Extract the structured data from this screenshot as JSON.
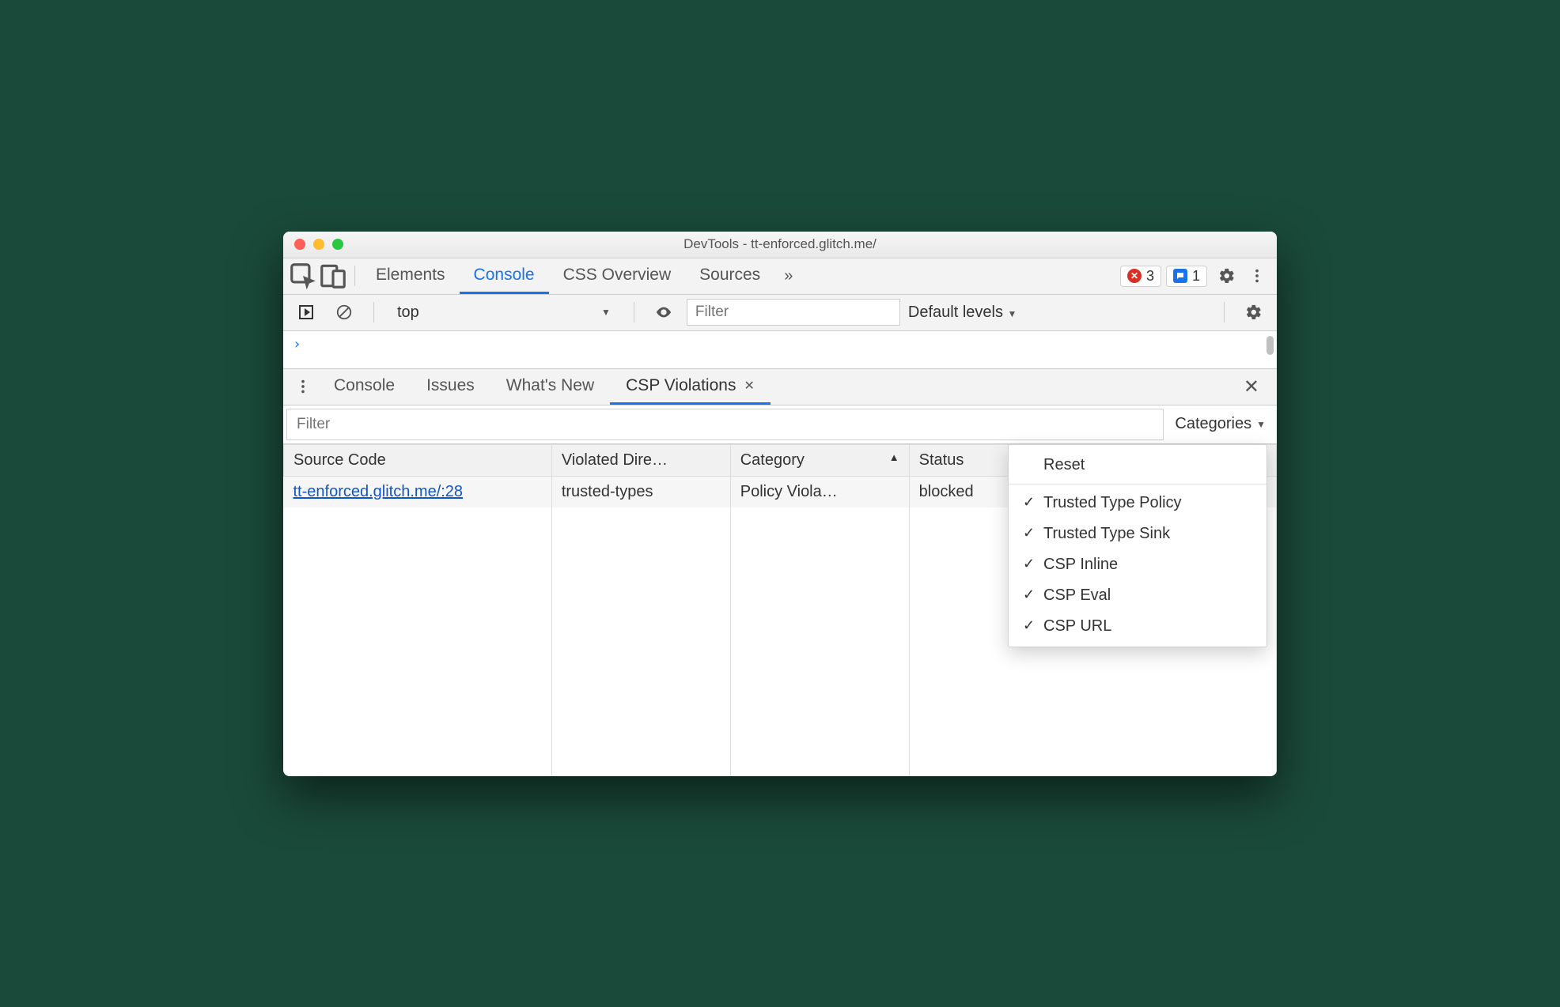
{
  "window": {
    "title": "DevTools - tt-enforced.glitch.me/"
  },
  "top_tabs": {
    "items": [
      "Elements",
      "Console",
      "CSS Overview",
      "Sources"
    ],
    "active_index": 1,
    "overflow_glyph": "»"
  },
  "badges": {
    "errors": "3",
    "messages": "1"
  },
  "console_toolbar": {
    "context": "top",
    "filter_placeholder": "Filter",
    "levels_label": "Default levels"
  },
  "prompt": "›",
  "drawer_tabs": {
    "items": [
      "Console",
      "Issues",
      "What's New",
      "CSP Violations"
    ],
    "active_index": 3
  },
  "csp_panel": {
    "filter_placeholder": "Filter",
    "categories_label": "Categories",
    "columns": {
      "source": "Source Code",
      "directive": "Violated Dire…",
      "category": "Category",
      "status": "Status"
    },
    "rows": [
      {
        "source": "tt-enforced.glitch.me/:28",
        "directive": "trusted-types",
        "category": "Policy Viola…",
        "status": "blocked"
      }
    ]
  },
  "categories_menu": {
    "reset": "Reset",
    "options": [
      "Trusted Type Policy",
      "Trusted Type Sink",
      "CSP Inline",
      "CSP Eval",
      "CSP URL"
    ]
  }
}
